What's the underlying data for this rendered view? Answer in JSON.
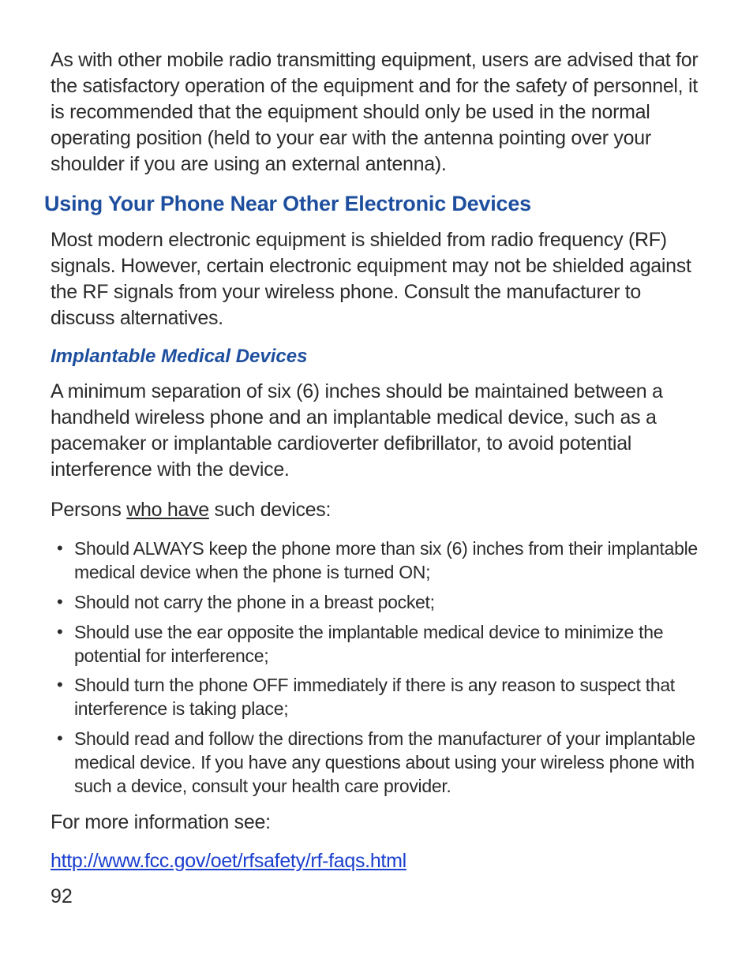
{
  "intro_paragraph": "As with other mobile radio transmitting equipment, users are advised that for the satisfactory operation of the equipment and for the safety of personnel, it is recommended that the equipment should only be used in the normal operating position (held to your ear with the antenna pointing over your shoulder if you are using an external antenna).",
  "section_heading": "Using Your Phone Near Other Electronic Devices",
  "section_paragraph": "Most modern electronic equipment is shielded from radio frequency (RF) signals. However, certain electronic equipment may not be shielded against the RF signals from your wireless phone. Consult the manufacturer to discuss alternatives.",
  "subheading": "Implantable Medical Devices",
  "sub_paragraph": "A minimum separation of six (6) inches should be maintained between a handheld wireless phone and an implantable medical device, such as a pacemaker or implantable cardioverter defibrillator, to avoid potential interference with the device.",
  "persons_line_prefix": "Persons ",
  "persons_line_underline": "who have",
  "persons_line_suffix": " such devices:",
  "bullets": [
    "Should ALWAYS keep the phone more than six (6) inches from their implantable medical device when the phone is turned ON;",
    "Should not carry the phone in a breast pocket;",
    "Should use the ear opposite the implantable medical device to minimize the potential for interference;",
    "Should turn the phone OFF immediately if there is any reason to suspect that interference is taking place;",
    "Should read and follow the directions from the manufacturer of your implantable medical device. If you have any questions about using your wireless phone with such a device, consult your health care provider."
  ],
  "more_info": "For more information see:",
  "link_text": "http://www.fcc.gov/oet/rfsafety/rf-faqs.html",
  "page_number": "92"
}
